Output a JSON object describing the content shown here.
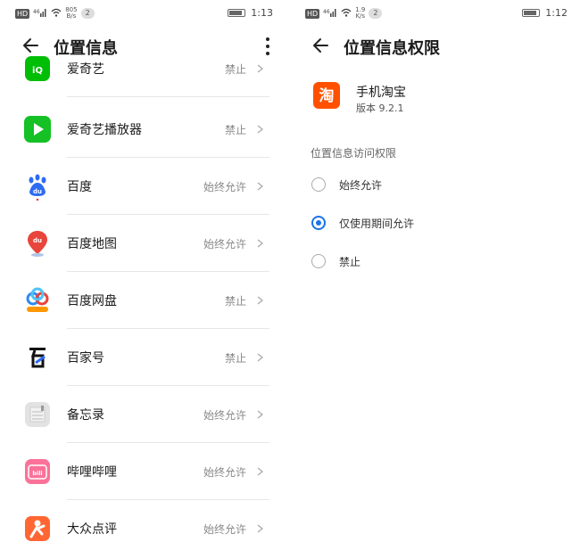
{
  "left": {
    "status": {
      "hd": "HD",
      "signal": "⁴⁶",
      "speed_value": "805",
      "speed_unit": "B/s",
      "notif": "2",
      "time": "1:13"
    },
    "title": "位置信息",
    "items": [
      {
        "name": "爱奇艺",
        "status": "禁止",
        "icon": "iqiyi-icon"
      },
      {
        "name": "爱奇艺播放器",
        "status": "禁止",
        "icon": "iqiyi-player-icon"
      },
      {
        "name": "百度",
        "status": "始终允许",
        "icon": "baidu-icon"
      },
      {
        "name": "百度地图",
        "status": "始终允许",
        "icon": "baidu-map-icon"
      },
      {
        "name": "百度网盘",
        "status": "禁止",
        "icon": "baidu-netdisk-icon"
      },
      {
        "name": "百家号",
        "status": "禁止",
        "icon": "baijiahao-icon"
      },
      {
        "name": "备忘录",
        "status": "始终允许",
        "icon": "notepad-icon"
      },
      {
        "name": "哔哩哔哩",
        "status": "始终允许",
        "icon": "bilibili-icon"
      },
      {
        "name": "大众点评",
        "status": "始终允许",
        "icon": "dianping-icon"
      }
    ]
  },
  "right": {
    "status": {
      "hd": "HD",
      "signal": "⁴⁶",
      "speed_value": "1.9",
      "speed_unit": "K/s",
      "notif": "2",
      "time": "1:12"
    },
    "title": "位置信息权限",
    "app": {
      "name": "手机淘宝",
      "version": "版本 9.2.1",
      "icon_char": "淘"
    },
    "section_label": "位置信息访问权限",
    "options": [
      {
        "label": "始终允许",
        "selected": false
      },
      {
        "label": "仅使用期间允许",
        "selected": true
      },
      {
        "label": "禁止",
        "selected": false
      }
    ]
  },
  "colors": {
    "accent": "#1a73e8",
    "taobao": "#ff5000"
  }
}
